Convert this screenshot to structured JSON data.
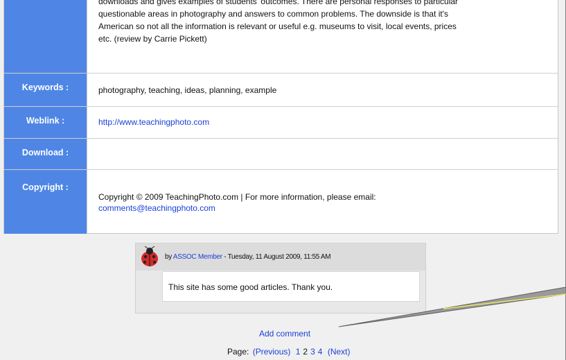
{
  "resource": {
    "description_lines": [
      "downloads and gives examples of students' outcomes. There are personal responses to particular",
      "questionable areas in photography and answers to common problems. The downside is that it's",
      "American so not all the information is relevant or useful e.g. museums to visit, local events, prices",
      "etc. (review by Carrie Pickett)"
    ],
    "keywords_label": "Keywords :",
    "keywords_value": "photography, teaching, ideas, planning, example",
    "weblink_label": "Weblink :",
    "weblink_value": "http://www.teachingphoto.com",
    "download_label": "Download :",
    "download_value": "",
    "copyright_label": "Copyright :",
    "copyright_line1": "Copyright © 2009 TeachingPhoto.com | For more information, please email:",
    "copyright_email": "comments@teachingphoto.com"
  },
  "comment": {
    "by_prefix": "by",
    "author": "ASSOC Member",
    "date_suffix": "- Tuesday, 11 August 2009, 11:55 AM",
    "text": "This site has some good articles. Thank you.",
    "avatar_icon": "ladybug-icon"
  },
  "add_comment": "Add comment",
  "pager": {
    "label": "Page:",
    "previous": "(Previous)",
    "pages": [
      "1",
      "2",
      "3",
      "4"
    ],
    "current": "2",
    "next": "(Next)"
  },
  "colors": {
    "label_bg": "#4f86e6",
    "link": "#1a3fd6",
    "pointer_highlight": "#f2f25a"
  }
}
